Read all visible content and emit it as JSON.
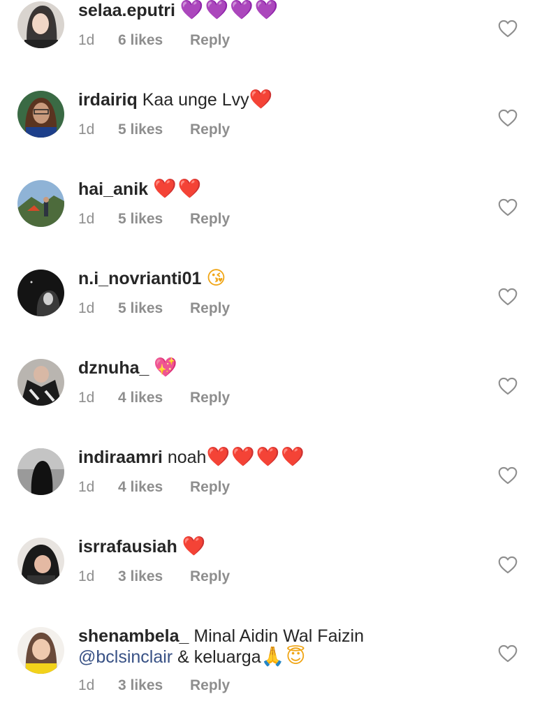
{
  "comments": [
    {
      "username": "selaa.eputri",
      "text": "",
      "emoji": "💜💜💜💜",
      "emoji_color": "purple",
      "time": "1d",
      "likes": "6 likes",
      "reply": "Reply"
    },
    {
      "username": "irdairiq",
      "text": "Kaa unge Lvy",
      "emoji": "❤️",
      "emoji_color": "red",
      "time": "1d",
      "likes": "5 likes",
      "reply": "Reply"
    },
    {
      "username": "hai_anik",
      "text": "",
      "emoji": "❤️❤️",
      "emoji_color": "red",
      "time": "1d",
      "likes": "5 likes",
      "reply": "Reply"
    },
    {
      "username": "n.i_novrianti01",
      "text": "",
      "emoji": "😘",
      "emoji_color": "yellow",
      "time": "1d",
      "likes": "5 likes",
      "reply": "Reply"
    },
    {
      "username": "dznuha_",
      "text": "",
      "emoji": "💖",
      "emoji_color": "pink",
      "time": "1d",
      "likes": "4 likes",
      "reply": "Reply"
    },
    {
      "username": "indiraamri",
      "text": "noah",
      "emoji": "❤️❤️❤️❤️",
      "emoji_color": "red",
      "time": "1d",
      "likes": "4 likes",
      "reply": "Reply"
    },
    {
      "username": "isrrafausiah",
      "text": "",
      "emoji": "❤️",
      "emoji_color": "red",
      "time": "1d",
      "likes": "3 likes",
      "reply": "Reply"
    },
    {
      "username": "shenambela_",
      "text": "Minal Aidin Wal Faizin",
      "mention": "@bclsinclair",
      "text2": "& keluarga",
      "emoji": "🙏😇",
      "emoji_color": "yellow",
      "time": "1d",
      "likes": "3 likes",
      "reply": "Reply"
    }
  ],
  "icons": {
    "like": "heart-outline-icon"
  },
  "colors": {
    "text": "#262626",
    "meta": "#8e8e8e",
    "mention": "#385185"
  }
}
